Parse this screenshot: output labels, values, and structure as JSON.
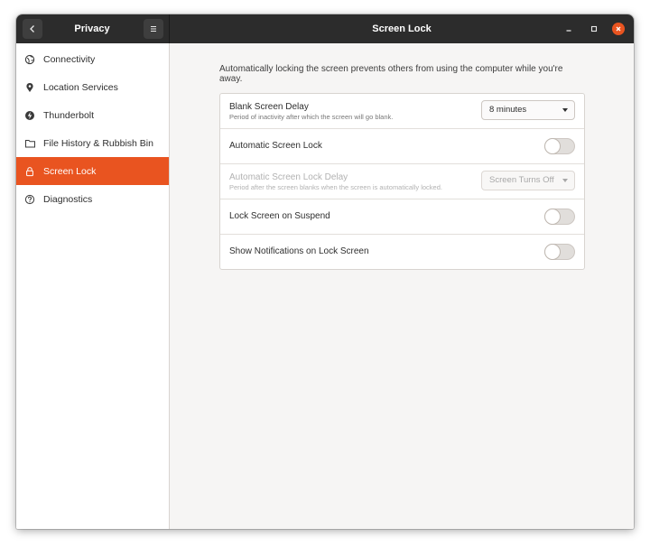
{
  "window": {
    "sidebar_title": "Privacy",
    "main_title": "Screen Lock"
  },
  "colors": {
    "accent": "#e95420",
    "headerbar": "#2c2c2c"
  },
  "sidebar": {
    "items": [
      {
        "label": "Connectivity",
        "icon": "globe-icon"
      },
      {
        "label": "Location Services",
        "icon": "location-pin-icon"
      },
      {
        "label": "Thunderbolt",
        "icon": "thunderbolt-icon"
      },
      {
        "label": "File History & Rubbish Bin",
        "icon": "folder-icon"
      },
      {
        "label": "Screen Lock",
        "icon": "lock-icon",
        "active": true
      },
      {
        "label": "Diagnostics",
        "icon": "help-circle-icon"
      }
    ]
  },
  "content": {
    "description": "Automatically locking the screen prevents others from using the computer while you're away.",
    "rows": {
      "blank_delay": {
        "title": "Blank Screen Delay",
        "subtitle": "Period of inactivity after which the screen will go blank.",
        "value": "8 minutes"
      },
      "auto_lock": {
        "title": "Automatic Screen Lock",
        "enabled": false
      },
      "auto_lock_delay": {
        "title": "Automatic Screen Lock Delay",
        "subtitle": "Period after the screen blanks when the screen is automatically locked.",
        "value": "Screen Turns Off",
        "disabled": true
      },
      "lock_on_suspend": {
        "title": "Lock Screen on Suspend",
        "enabled": false
      },
      "show_notifications": {
        "title": "Show Notifications on Lock Screen",
        "enabled": false
      }
    }
  }
}
